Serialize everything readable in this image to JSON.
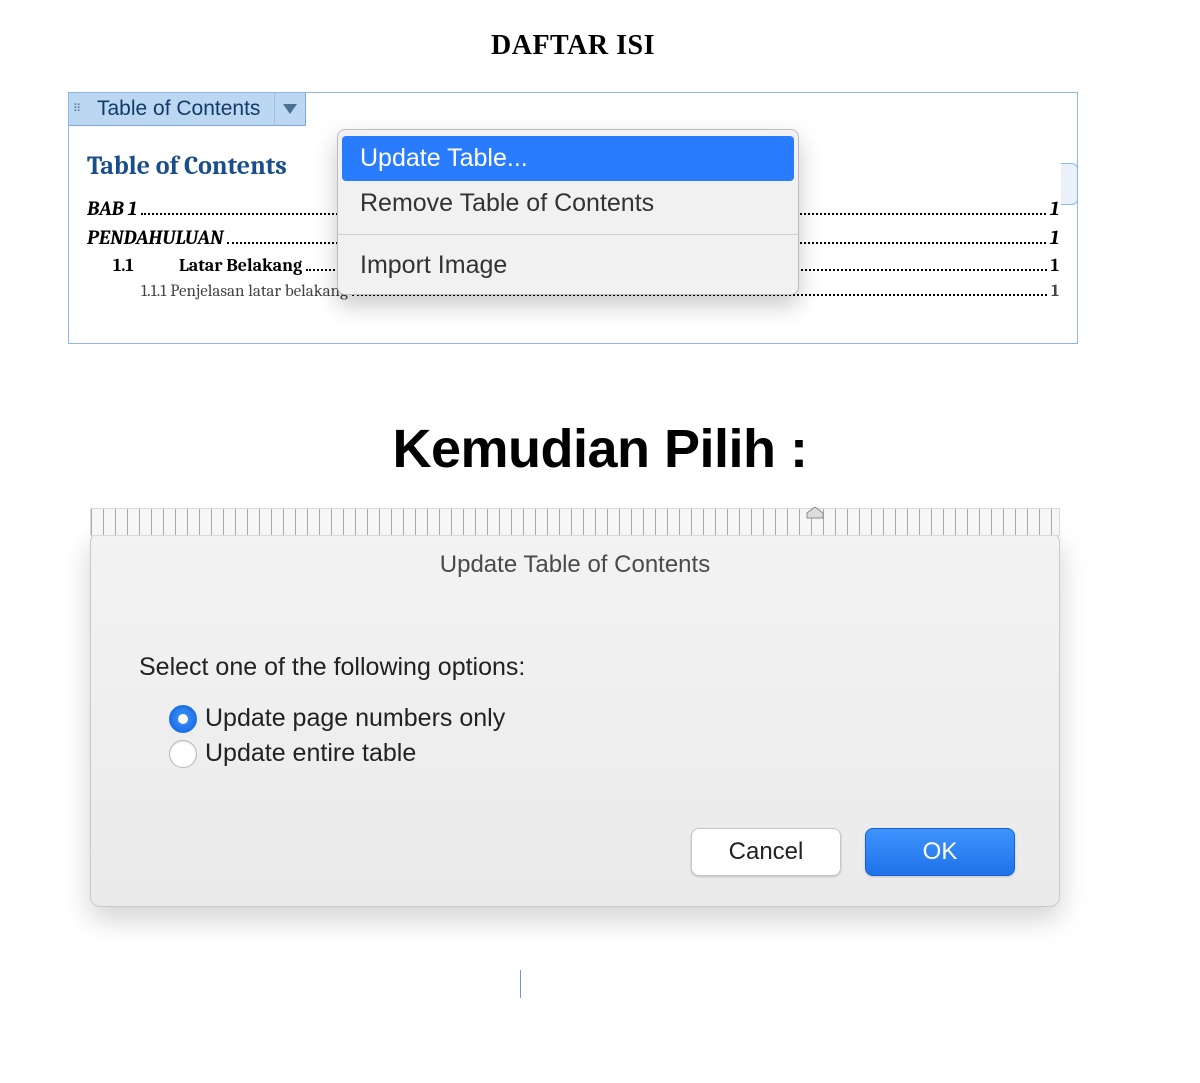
{
  "doc": {
    "heading": "DAFTAR ISI"
  },
  "toc_tab": {
    "label": "Table of Contents"
  },
  "toc": {
    "title": "Table of Contents",
    "entries": [
      {
        "label": "BAB 1",
        "page": "1",
        "level": 0
      },
      {
        "label": "PENDAHULUAN",
        "page": "1",
        "level": 0
      },
      {
        "num": "1.1",
        "label": "Latar Belakang",
        "page": "1",
        "level": 1
      },
      {
        "num": "1.1.1",
        "label": "Penjelasan latar belakang",
        "page": "1",
        "level": 2
      }
    ]
  },
  "dropdown": {
    "items": [
      {
        "label": "Update Table...",
        "highlighted": true
      },
      {
        "label": "Remove Table of Contents",
        "highlighted": false
      }
    ],
    "secondary": [
      {
        "label": "Import Image"
      }
    ]
  },
  "caption": "Kemudian Pilih :",
  "dialog": {
    "title": "Update Table of Contents",
    "prompt": "Select one of the following options:",
    "options": [
      {
        "label": "Update page numbers only",
        "selected": true
      },
      {
        "label": "Update entire table",
        "selected": false
      }
    ],
    "buttons": {
      "cancel": "Cancel",
      "ok": "OK"
    }
  }
}
